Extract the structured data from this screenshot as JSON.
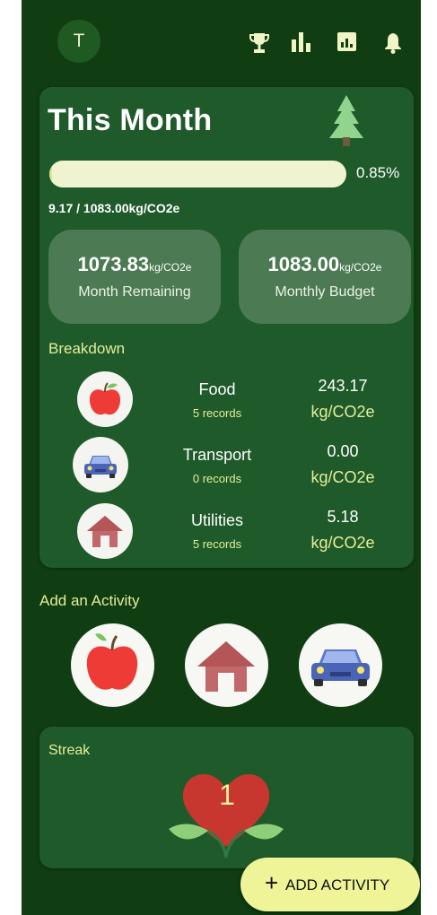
{
  "header": {
    "avatar_initial": "T",
    "icons": [
      "trophy-icon",
      "bar-chart-icon",
      "report-icon",
      "bell-icon"
    ]
  },
  "month_card": {
    "title": "This Month",
    "progress_fraction": 0.0085,
    "progress_label": "0.85%",
    "usage_text": "9.17 / 1083.00kg/CO2e",
    "remaining": {
      "value": "1073.83",
      "unit": "kg/CO2e",
      "label": "Month Remaining"
    },
    "budget": {
      "value": "1083.00",
      "unit": "kg/CO2e",
      "label": "Monthly Budget"
    }
  },
  "breakdown": {
    "label": "Breakdown",
    "items": [
      {
        "icon": "apple-icon",
        "name": "Food",
        "records": "5 records",
        "amount": "243.17",
        "unit": "kg/CO2e"
      },
      {
        "icon": "car-icon",
        "name": "Transport",
        "records": "0 records",
        "amount": "0.00",
        "unit": "kg/CO2e"
      },
      {
        "icon": "house-icon",
        "name": "Utilities",
        "records": "5 records",
        "amount": "5.18",
        "unit": "kg/CO2e"
      }
    ]
  },
  "add_activity": {
    "label": "Add an Activity",
    "buttons": [
      "apple-icon",
      "house-icon",
      "car-icon"
    ]
  },
  "streak": {
    "label": "Streak",
    "count": "1"
  },
  "fab": {
    "plus": "+",
    "label": "ADD ACTIVITY"
  },
  "colors": {
    "background": "#103d12",
    "card": "#1f5a2a",
    "accent": "#e5ee99",
    "progress_track": "#f0f3cf",
    "fab": "#eef497"
  }
}
